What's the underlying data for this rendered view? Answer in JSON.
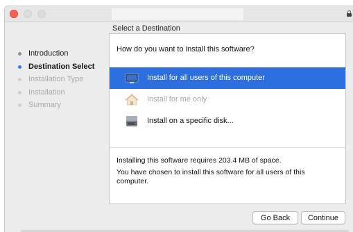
{
  "window": {
    "title": ""
  },
  "pane": {
    "heading": "Select a Destination"
  },
  "sidebar": {
    "steps": [
      {
        "label": "Introduction",
        "state": "done"
      },
      {
        "label": "Destination Select",
        "state": "current"
      },
      {
        "label": "Installation Type",
        "state": "future"
      },
      {
        "label": "Installation",
        "state": "future"
      },
      {
        "label": "Summary",
        "state": "future"
      }
    ]
  },
  "content": {
    "question": "How do you want to install this software?",
    "options": [
      {
        "label": "Install for all users of this computer",
        "icon": "computer-icon",
        "state": "selected"
      },
      {
        "label": "Install for me only",
        "icon": "home-icon",
        "state": "disabled"
      },
      {
        "label": "Install on a specific disk...",
        "icon": "disk-icon",
        "state": "normal"
      }
    ],
    "space_text": "Installing this software requires 203.4 MB of space.",
    "summary_text": "You have chosen to install this software for all users of this computer."
  },
  "buttons": {
    "back_label": "Go Back",
    "continue_label": "Continue"
  },
  "colors": {
    "accent": "#2e6fe0",
    "current_step_dot": "#2f7bf5",
    "close_button": "#fc5f57"
  }
}
